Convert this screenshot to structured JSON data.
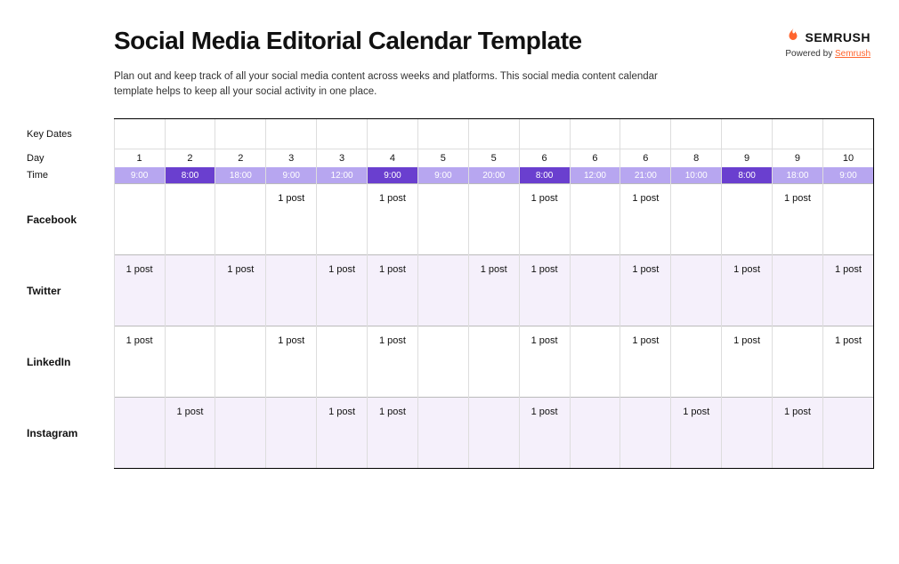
{
  "header": {
    "title": "Social Media Editorial Calendar Template",
    "subtitle": "Plan out and keep track of all your social media content across weeks and platforms. This social media content calendar template helps to keep all your social activity in one place.",
    "brand_word": "SEMRUSH",
    "powered_prefix": "Powered by ",
    "powered_link": "Semrush"
  },
  "rows": {
    "key_dates_label": "Key Dates",
    "day_label": "Day",
    "time_label": "Time"
  },
  "columns": [
    {
      "day": "1",
      "time": "9:00",
      "shade": "light"
    },
    {
      "day": "2",
      "time": "8:00",
      "shade": "dark"
    },
    {
      "day": "2",
      "time": "18:00",
      "shade": "light"
    },
    {
      "day": "3",
      "time": "9:00",
      "shade": "light"
    },
    {
      "day": "3",
      "time": "12:00",
      "shade": "light"
    },
    {
      "day": "4",
      "time": "9:00",
      "shade": "dark"
    },
    {
      "day": "5",
      "time": "9:00",
      "shade": "light"
    },
    {
      "day": "5",
      "time": "20:00",
      "shade": "light"
    },
    {
      "day": "6",
      "time": "8:00",
      "shade": "dark"
    },
    {
      "day": "6",
      "time": "12:00",
      "shade": "light"
    },
    {
      "day": "6",
      "time": "21:00",
      "shade": "light"
    },
    {
      "day": "8",
      "time": "10:00",
      "shade": "light"
    },
    {
      "day": "9",
      "time": "8:00",
      "shade": "dark"
    },
    {
      "day": "9",
      "time": "18:00",
      "shade": "light"
    },
    {
      "day": "10",
      "time": "9:00",
      "shade": "light"
    }
  ],
  "platforms": [
    {
      "name": "Facebook",
      "band": false,
      "cells": [
        "",
        "",
        "",
        "1 post",
        "",
        "1 post",
        "",
        "",
        "1 post",
        "",
        "1 post",
        "",
        "",
        "1 post",
        ""
      ]
    },
    {
      "name": "Twitter",
      "band": true,
      "cells": [
        "1 post",
        "",
        "1 post",
        "",
        "1 post",
        "1 post",
        "",
        "1 post",
        "1 post",
        "",
        "1 post",
        "",
        "1 post",
        "",
        "1 post"
      ]
    },
    {
      "name": "LinkedIn",
      "band": false,
      "cells": [
        "1 post",
        "",
        "",
        "1 post",
        "",
        "1 post",
        "",
        "",
        "1 post",
        "",
        "1 post",
        "",
        "1 post",
        "",
        "1 post"
      ]
    },
    {
      "name": "Instagram",
      "band": true,
      "cells": [
        "",
        "1 post",
        "",
        "",
        "1 post",
        "1 post",
        "",
        "",
        "1 post",
        "",
        "",
        "1 post",
        "",
        "1 post",
        ""
      ]
    }
  ]
}
